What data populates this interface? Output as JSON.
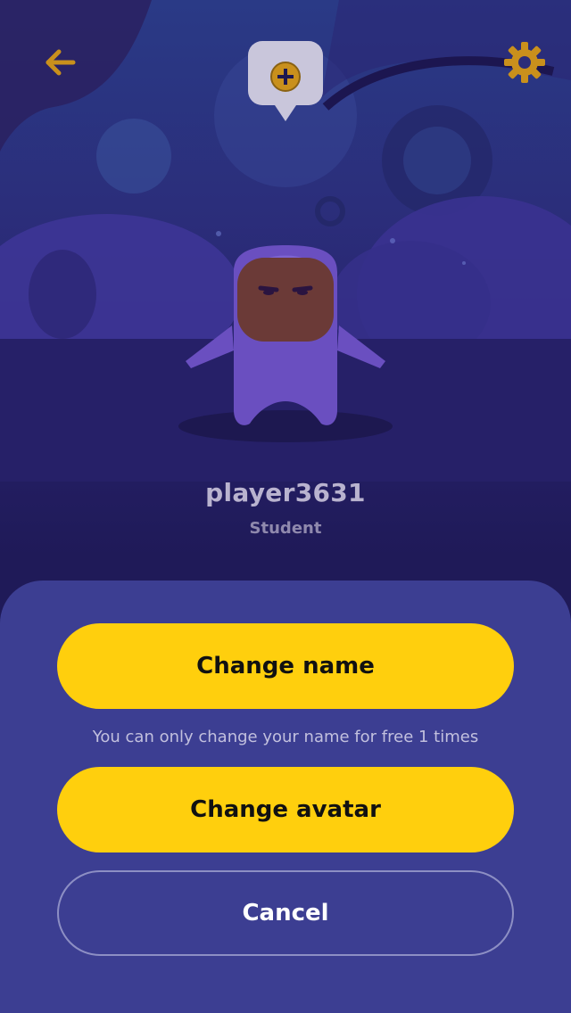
{
  "header": {
    "back_icon": "arrow-left-icon",
    "settings_icon": "gear-icon",
    "add_icon": "plus-circle-icon"
  },
  "profile": {
    "username": "player3631",
    "role": "Student"
  },
  "actions": {
    "change_name_label": "Change name",
    "name_hint": "You can only change your name for free 1 times",
    "change_avatar_label": "Change avatar",
    "cancel_label": "Cancel"
  },
  "colors": {
    "accent_yellow": "#ffcf0d",
    "icon_gold": "#c9901c",
    "sheet_bg": "#3c3e92",
    "page_bg": "#1e1a55"
  }
}
